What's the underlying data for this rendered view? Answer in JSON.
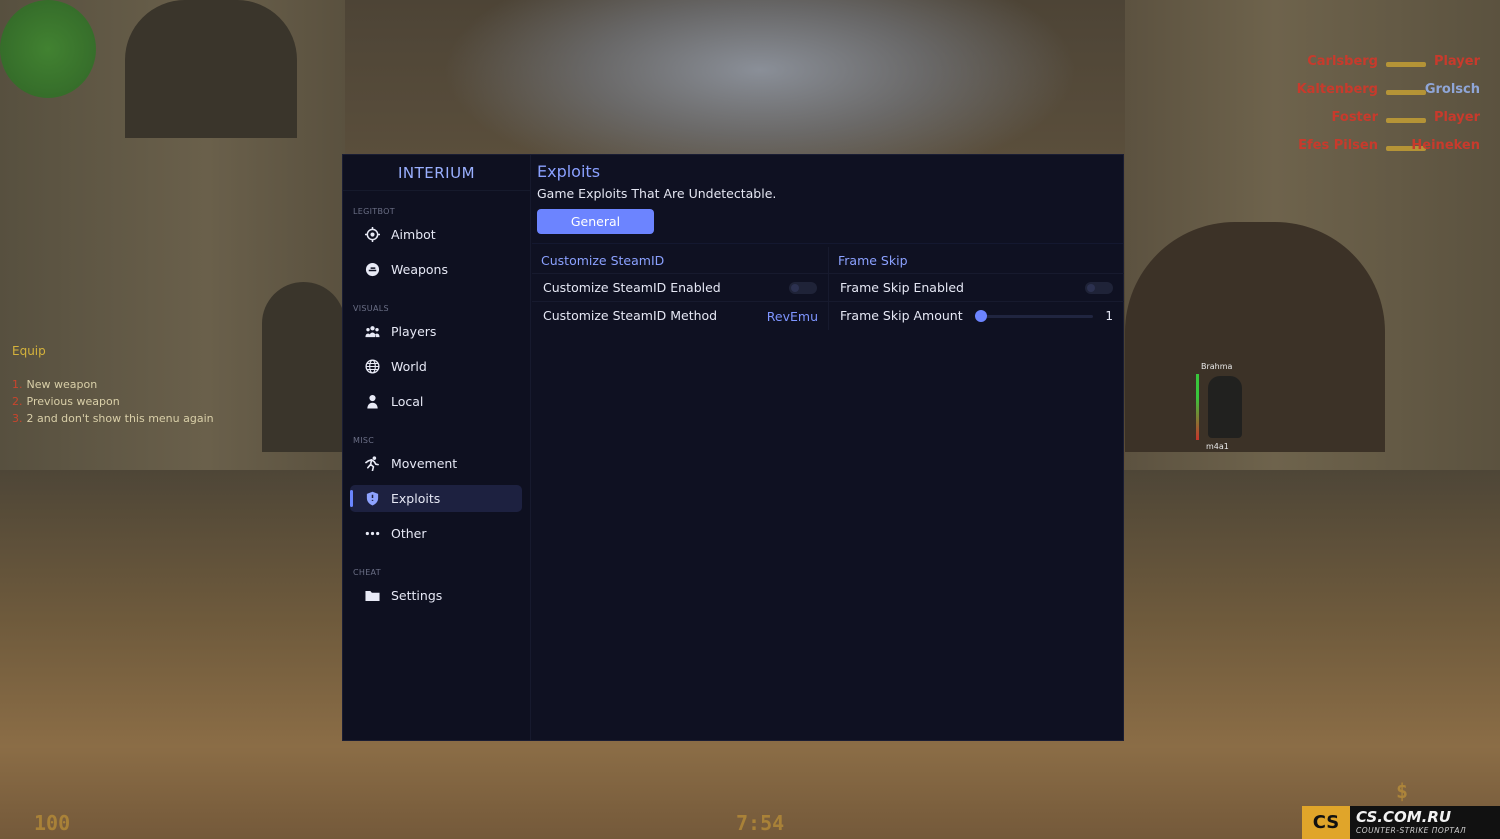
{
  "game_hud": {
    "killfeed": [
      {
        "killer": "Carlsberg",
        "victim": "Player",
        "killer_team": "red",
        "victim_team": "red"
      },
      {
        "killer": "Kaltenberg",
        "victim": "Grolsch",
        "killer_team": "red",
        "victim_team": "blue"
      },
      {
        "killer": "Foster",
        "victim": "Player",
        "killer_team": "red",
        "victim_team": "red"
      },
      {
        "killer": "Efes Pilsen",
        "victim": "Heineken",
        "killer_team": "red",
        "victim_team": "red"
      }
    ],
    "equip_menu": {
      "title": "Equip",
      "items": [
        {
          "num": "1.",
          "label": "New weapon"
        },
        {
          "num": "2.",
          "label": "Previous weapon"
        },
        {
          "num": "3.",
          "label": "2 and don't show this menu again"
        }
      ]
    },
    "esp": {
      "name": "Brahma",
      "weapon": "m4a1"
    },
    "health": "100",
    "timer": "7:54",
    "money": "$",
    "watermark": {
      "logo": "CS",
      "main": "CS.COM.RU",
      "sub": "COUNTER-STRIKE ПОРТАЛ"
    }
  },
  "cheat_menu": {
    "brand": "INTERIUM",
    "sections": [
      {
        "label": "LEGITBOT",
        "items": [
          {
            "label": "Aimbot",
            "icon": "crosshair-icon"
          },
          {
            "label": "Weapons",
            "icon": "weapons-icon"
          }
        ]
      },
      {
        "label": "VISUALS",
        "items": [
          {
            "label": "Players",
            "icon": "players-icon"
          },
          {
            "label": "World",
            "icon": "globe-icon"
          },
          {
            "label": "Local",
            "icon": "user-icon"
          }
        ]
      },
      {
        "label": "MISC",
        "items": [
          {
            "label": "Movement",
            "icon": "running-icon"
          },
          {
            "label": "Exploits",
            "icon": "shield-icon",
            "active": true
          },
          {
            "label": "Other",
            "icon": "ellipsis-icon"
          }
        ]
      },
      {
        "label": "CHEAT",
        "items": [
          {
            "label": "Settings",
            "icon": "folder-icon"
          }
        ]
      }
    ],
    "page": {
      "title": "Exploits",
      "subtitle": "Game Exploits That Are Undetectable.",
      "tab": "General"
    },
    "panels": {
      "left": {
        "title": "Customize SteamID",
        "rows": [
          {
            "label": "Customize SteamID Enabled",
            "type": "toggle",
            "enabled": false
          },
          {
            "label": "Customize SteamID Method",
            "type": "select",
            "value": "RevEmu"
          }
        ]
      },
      "right": {
        "title": "Frame Skip",
        "rows": [
          {
            "label": "Frame Skip Enabled",
            "type": "toggle",
            "enabled": false
          },
          {
            "label": "Frame Skip Amount",
            "type": "slider",
            "value": "1",
            "fraction": 0
          }
        ]
      }
    },
    "colors": {
      "accent": "#6c84ff",
      "background": "#0f1122",
      "active_item": "#1d2140"
    }
  }
}
